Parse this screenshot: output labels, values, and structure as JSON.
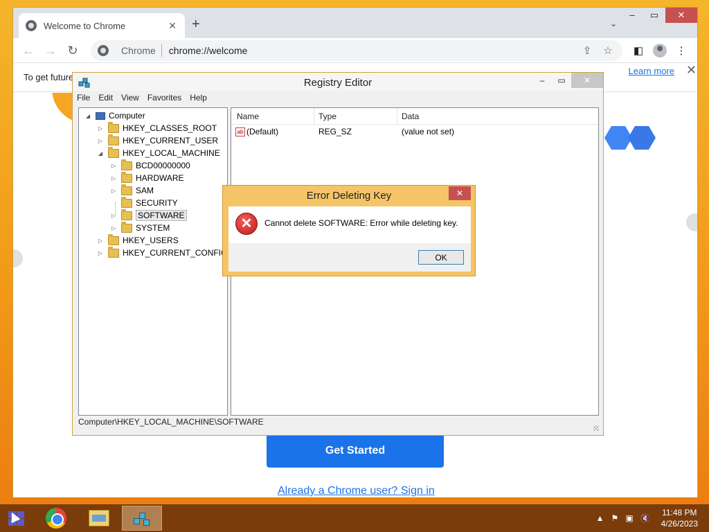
{
  "chrome": {
    "tab_title": "Welcome to Chrome",
    "new_tab": "+",
    "omnibox_site": "Chrome",
    "omnibox_url": "chrome://welcome",
    "infobar_text": "To get future",
    "infobar_link": "Learn more",
    "get_started": "Get Started",
    "sign_in": "Already a Chrome user? Sign in"
  },
  "regedit": {
    "title": "Registry Editor",
    "menu": [
      "File",
      "Edit",
      "View",
      "Favorites",
      "Help"
    ],
    "tree": {
      "root": "Computer",
      "items": [
        "HKEY_CLASSES_ROOT",
        "HKEY_CURRENT_USER",
        "HKEY_LOCAL_MACHINE",
        "BCD00000000",
        "HARDWARE",
        "SAM",
        "SECURITY",
        "SOFTWARE",
        "SYSTEM",
        "HKEY_USERS",
        "HKEY_CURRENT_CONFIG"
      ]
    },
    "columns": {
      "name": "Name",
      "type": "Type",
      "data": "Data"
    },
    "rows": [
      {
        "name": "(Default)",
        "type": "REG_SZ",
        "data": "(value not set)"
      }
    ],
    "status_path": "Computer\\HKEY_LOCAL_MACHINE\\SOFTWARE"
  },
  "error_dialog": {
    "title": "Error Deleting Key",
    "message": "Cannot delete SOFTWARE:  Error while deleting key.",
    "ok_label": "OK"
  },
  "taskbar": {
    "time": "11:48 PM",
    "date": "4/26/2023"
  },
  "icons": {
    "favicon": "chrome-favicon-icon",
    "back": "back-arrow-icon",
    "forward": "forward-arrow-icon",
    "reload": "reload-icon",
    "share": "share-icon",
    "star": "bookmark-star-icon",
    "sidepanel": "side-panel-icon",
    "profile": "profile-avatar-icon",
    "menu": "kebab-menu-icon",
    "error": "error-x-icon"
  },
  "colors": {
    "accent_blue": "#1a73e8",
    "desktop_orange": "#f29a1a",
    "taskbar_brown": "#7a3c0a",
    "dialog_frame": "#f4c466",
    "close_red": "#c75050"
  }
}
